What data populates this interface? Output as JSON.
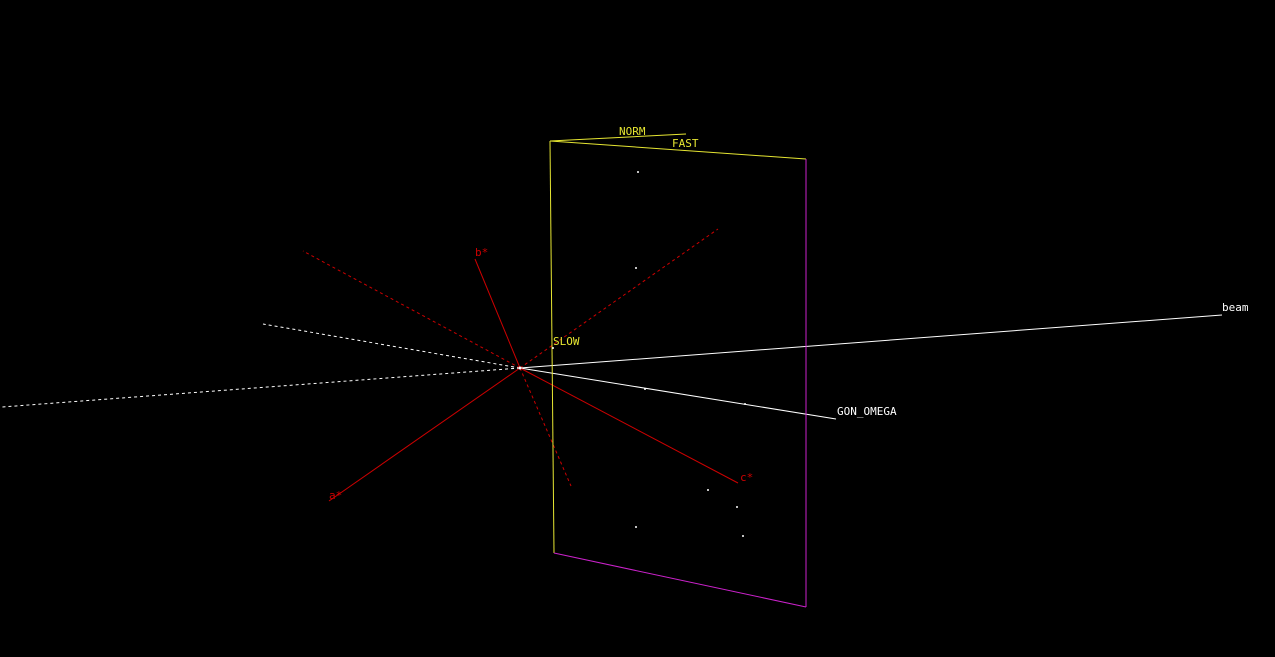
{
  "scene": {
    "background": "#000000",
    "labels": {
      "beam": "beam",
      "gon_omega": "GON_OMEGA",
      "a_star": "a*",
      "b_star": "b*",
      "c_star": "c*",
      "norm": "NORM",
      "fast": "FAST",
      "slow": "SLOW"
    },
    "colors": {
      "beam_axis": "#ffffff",
      "goniometer_axis": "#ffffff",
      "reciprocal_axes": "#cc0000",
      "detector_fast_slow_edges": "#e6e632",
      "detector_other_edges": "#cc22cc",
      "spots": "#ffffff"
    },
    "spots_visible": 9
  }
}
